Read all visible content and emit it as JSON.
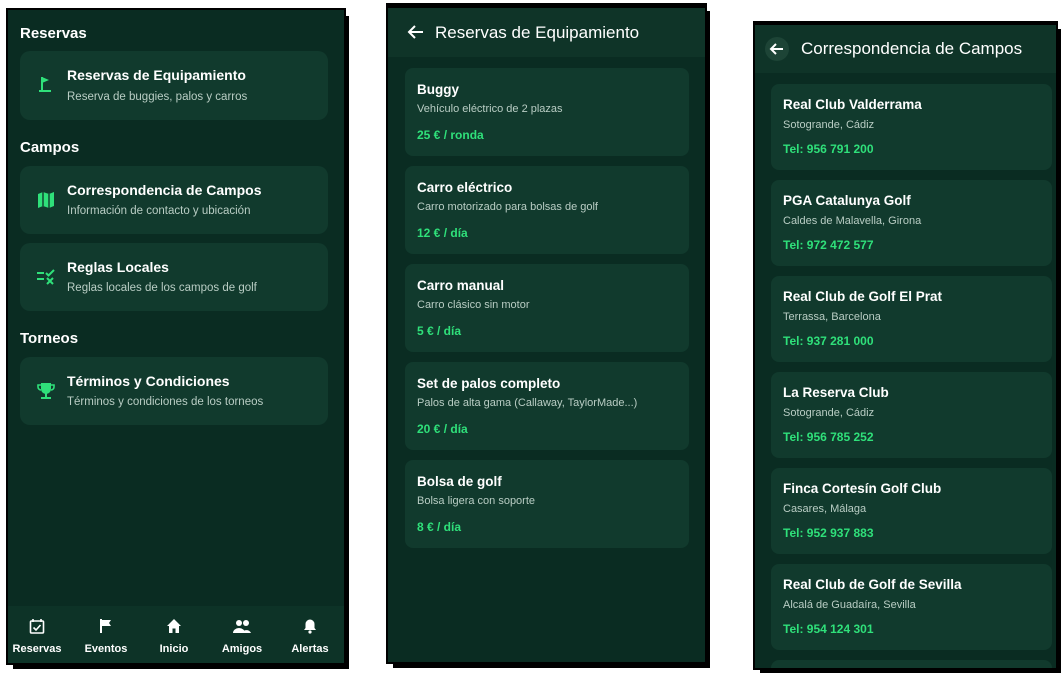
{
  "colors": {
    "background": "#0a2c22",
    "card": "#113a2d",
    "accent": "#2fe07a",
    "text": "#ffffff",
    "subtext": "#b9cdc4"
  },
  "menu": {
    "sections": [
      {
        "title": "Reservas",
        "items": [
          {
            "icon": "golf-flag-icon",
            "title": "Reservas de Equipamiento",
            "subtitle": "Reserva de buggies, palos y carros"
          }
        ]
      },
      {
        "title": "Campos",
        "items": [
          {
            "icon": "map-icon",
            "title": "Correspondencia de Campos",
            "subtitle": "Información de contacto y ubicación"
          },
          {
            "icon": "rule-icon",
            "title": "Reglas Locales",
            "subtitle": "Reglas locales de los campos de golf"
          }
        ]
      },
      {
        "title": "Torneos",
        "items": [
          {
            "icon": "trophy-icon",
            "title": "Términos y Condiciones",
            "subtitle": "Términos y condiciones de los torneos"
          }
        ]
      }
    ],
    "nav": [
      {
        "icon": "calendar-check-icon",
        "label": "Reservas"
      },
      {
        "icon": "flag-icon",
        "label": "Eventos"
      },
      {
        "icon": "home-icon",
        "label": "Inicio"
      },
      {
        "icon": "people-icon",
        "label": "Amigos"
      },
      {
        "icon": "bell-icon",
        "label": "Alertas"
      }
    ]
  },
  "equipment": {
    "title": "Reservas de Equipamiento",
    "items": [
      {
        "name": "Buggy",
        "description": "Vehículo eléctrico de 2 plazas",
        "price": "25 € / ronda"
      },
      {
        "name": "Carro eléctrico",
        "description": "Carro motorizado para bolsas de golf",
        "price": "12 € / día"
      },
      {
        "name": "Carro manual",
        "description": "Carro clásico sin motor",
        "price": "5 € / día"
      },
      {
        "name": "Set de palos completo",
        "description": "Palos de alta gama (Callaway, TaylorMade...)",
        "price": "20 € / día"
      },
      {
        "name": "Bolsa de golf",
        "description": "Bolsa ligera con soporte",
        "price": "8 € / día"
      }
    ]
  },
  "courses": {
    "title": "Correspondencia de Campos",
    "items": [
      {
        "name": "Real Club Valderrama",
        "location": "Sotogrande, Cádiz",
        "phone": "Tel: 956 791 200"
      },
      {
        "name": "PGA Catalunya Golf",
        "location": "Caldes de Malavella, Girona",
        "phone": "Tel: 972 472 577"
      },
      {
        "name": "Real Club de Golf El Prat",
        "location": "Terrassa, Barcelona",
        "phone": "Tel: 937 281 000"
      },
      {
        "name": "La Reserva Club",
        "location": "Sotogrande, Cádiz",
        "phone": "Tel: 956 785 252"
      },
      {
        "name": "Finca Cortesín Golf Club",
        "location": "Casares, Málaga",
        "phone": "Tel: 952 937 883"
      },
      {
        "name": "Real Club de Golf de Sevilla",
        "location": "Alcalá de Guadaíra, Sevilla",
        "phone": "Tel: 954 124 301"
      }
    ]
  }
}
